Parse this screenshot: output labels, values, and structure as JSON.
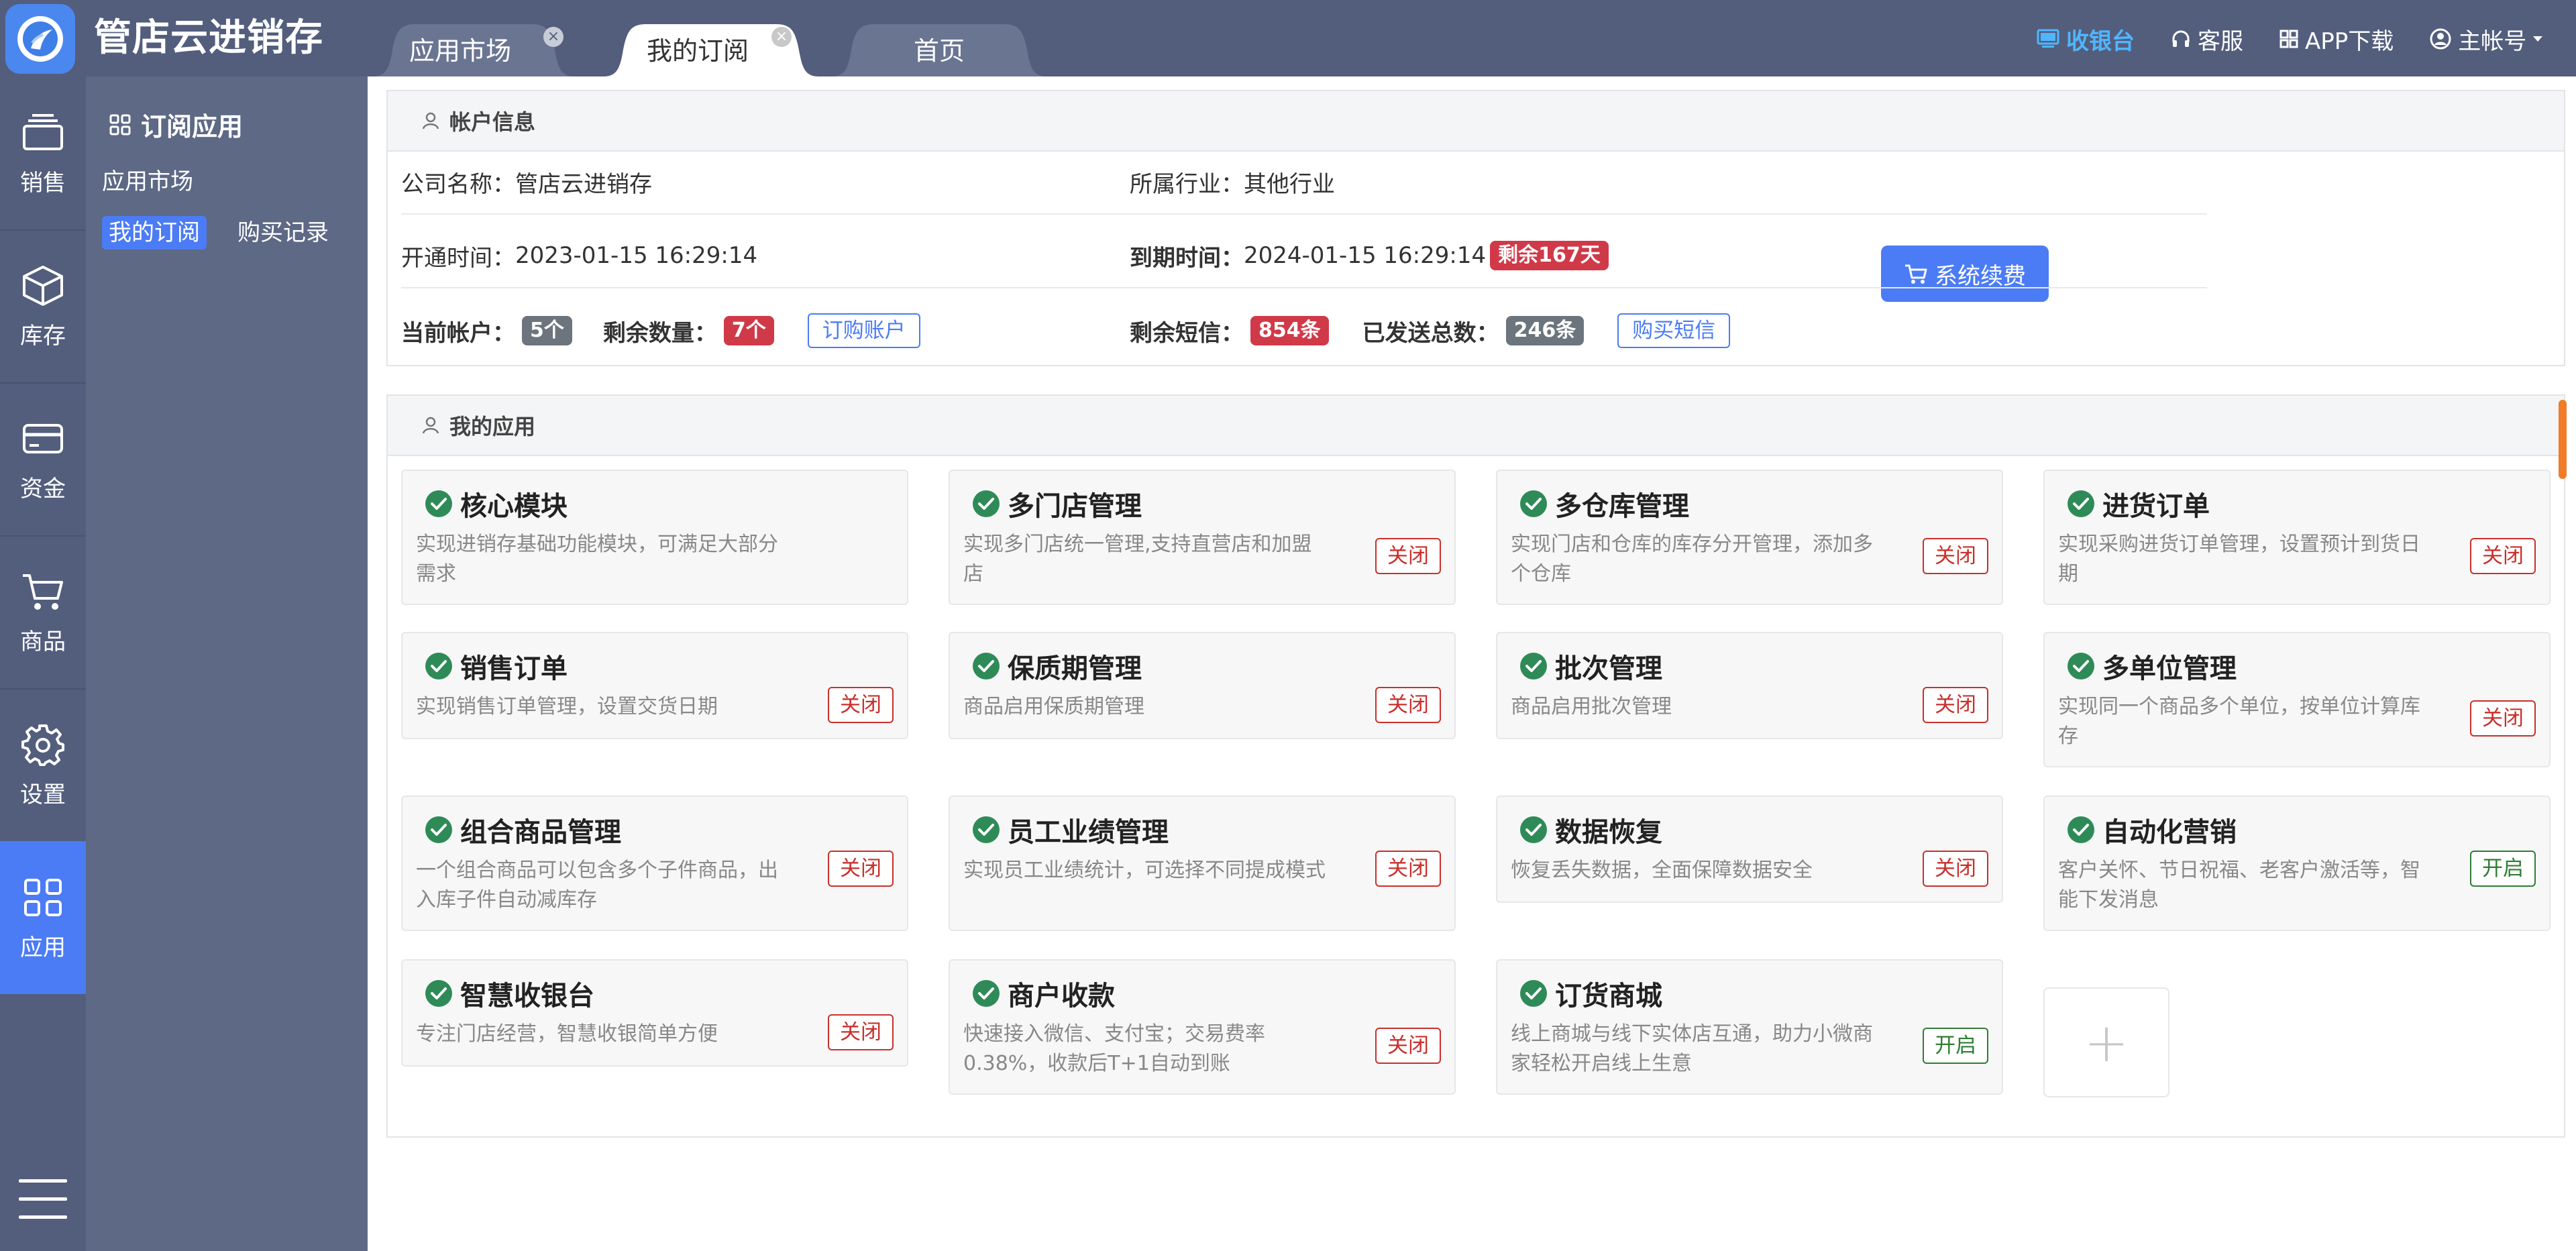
{
  "app": {
    "title": "管店云进销存"
  },
  "tabs": [
    {
      "label": "应用市场",
      "close": "×"
    },
    {
      "label": "我的订阅",
      "close": "×"
    },
    {
      "label": "首页"
    }
  ],
  "topnav": {
    "cashier": "收银台",
    "service": "客服",
    "app_download": "APP下载",
    "account": "主帐号"
  },
  "sidebar": {
    "items": [
      {
        "label": "销售",
        "icon": "sales-icon"
      },
      {
        "label": "库存",
        "icon": "inventory-box-icon"
      },
      {
        "label": "资金",
        "icon": "wallet-card-icon"
      },
      {
        "label": "商品",
        "icon": "cart-icon"
      },
      {
        "label": "设置",
        "icon": "gear-icon"
      },
      {
        "label": "应用",
        "icon": "grid-apps-icon",
        "active": true
      }
    ]
  },
  "submenu": {
    "title": "订阅应用",
    "market": "应用市场",
    "my_subs": "我的订阅",
    "purchases": "购买记录"
  },
  "account": {
    "header": "帐户信息",
    "company_label": "公司名称：",
    "company": "管店云进销存",
    "industry_label": "所属行业：",
    "industry": "其他行业",
    "open_label": "开通时间：",
    "open_time": "2023-01-15 16:29:14",
    "expire_label": "到期时间：",
    "expire_time": "2024-01-15 16:29:14",
    "remaining_days": "剩余167天",
    "renew": "系统续费",
    "current_accounts_label": "当前帐户：",
    "current_accounts": "5个",
    "remaining_qty_label": "剩余数量：",
    "remaining_qty": "7个",
    "buy_accounts": "订购账户",
    "sms_left_label": "剩余短信：",
    "sms_left": "854条",
    "sms_sent_label": "已发送总数：",
    "sms_sent": "246条",
    "buy_sms": "购买短信"
  },
  "apps": {
    "header": "我的应用",
    "add": "+",
    "items": [
      {
        "name": "核心模块",
        "desc": "实现进销存基础功能模块，可满足大部分需求",
        "toggle": ""
      },
      {
        "name": "多门店管理",
        "desc": "实现多门店统一管理,支持直营店和加盟店",
        "toggle": "关闭"
      },
      {
        "name": "多仓库管理",
        "desc": "实现门店和仓库的库存分开管理，添加多个仓库",
        "toggle": "关闭"
      },
      {
        "name": "进货订单",
        "desc": "实现采购进货订单管理，设置预计到货日期",
        "toggle": "关闭"
      },
      {
        "name": "销售订单",
        "desc": "实现销售订单管理，设置交货日期",
        "toggle": "关闭"
      },
      {
        "name": "保质期管理",
        "desc": "商品启用保质期管理",
        "toggle": "关闭"
      },
      {
        "name": "批次管理",
        "desc": "商品启用批次管理",
        "toggle": "关闭"
      },
      {
        "name": "多单位管理",
        "desc": "实现同一个商品多个单位，按单位计算库存",
        "toggle": "关闭"
      },
      {
        "name": "组合商品管理",
        "desc": "一个组合商品可以包含多个子件商品，出入库子件自动减库存",
        "toggle": "关闭"
      },
      {
        "name": "员工业绩管理",
        "desc": "实现员工业绩统计，可选择不同提成模式",
        "toggle": "关闭"
      },
      {
        "name": "数据恢复",
        "desc": "恢复丢失数据，全面保障数据安全",
        "toggle": "关闭"
      },
      {
        "name": "自动化营销",
        "desc": "客户关怀、节日祝福、老客户激活等，智能下发消息",
        "toggle": "开启"
      },
      {
        "name": "智慧收银台",
        "desc": "专注门店经营，智慧收银简单方便",
        "toggle": "关闭"
      },
      {
        "name": "商户收款",
        "desc": "快速接入微信、支付宝；交易费率0.38%，收款后T+1自动到账",
        "toggle": "关闭"
      },
      {
        "name": "订货商城",
        "desc": "线上商城与线下实体店互通，助力小微商家轻松开启线上生意",
        "toggle": "开启"
      }
    ]
  }
}
